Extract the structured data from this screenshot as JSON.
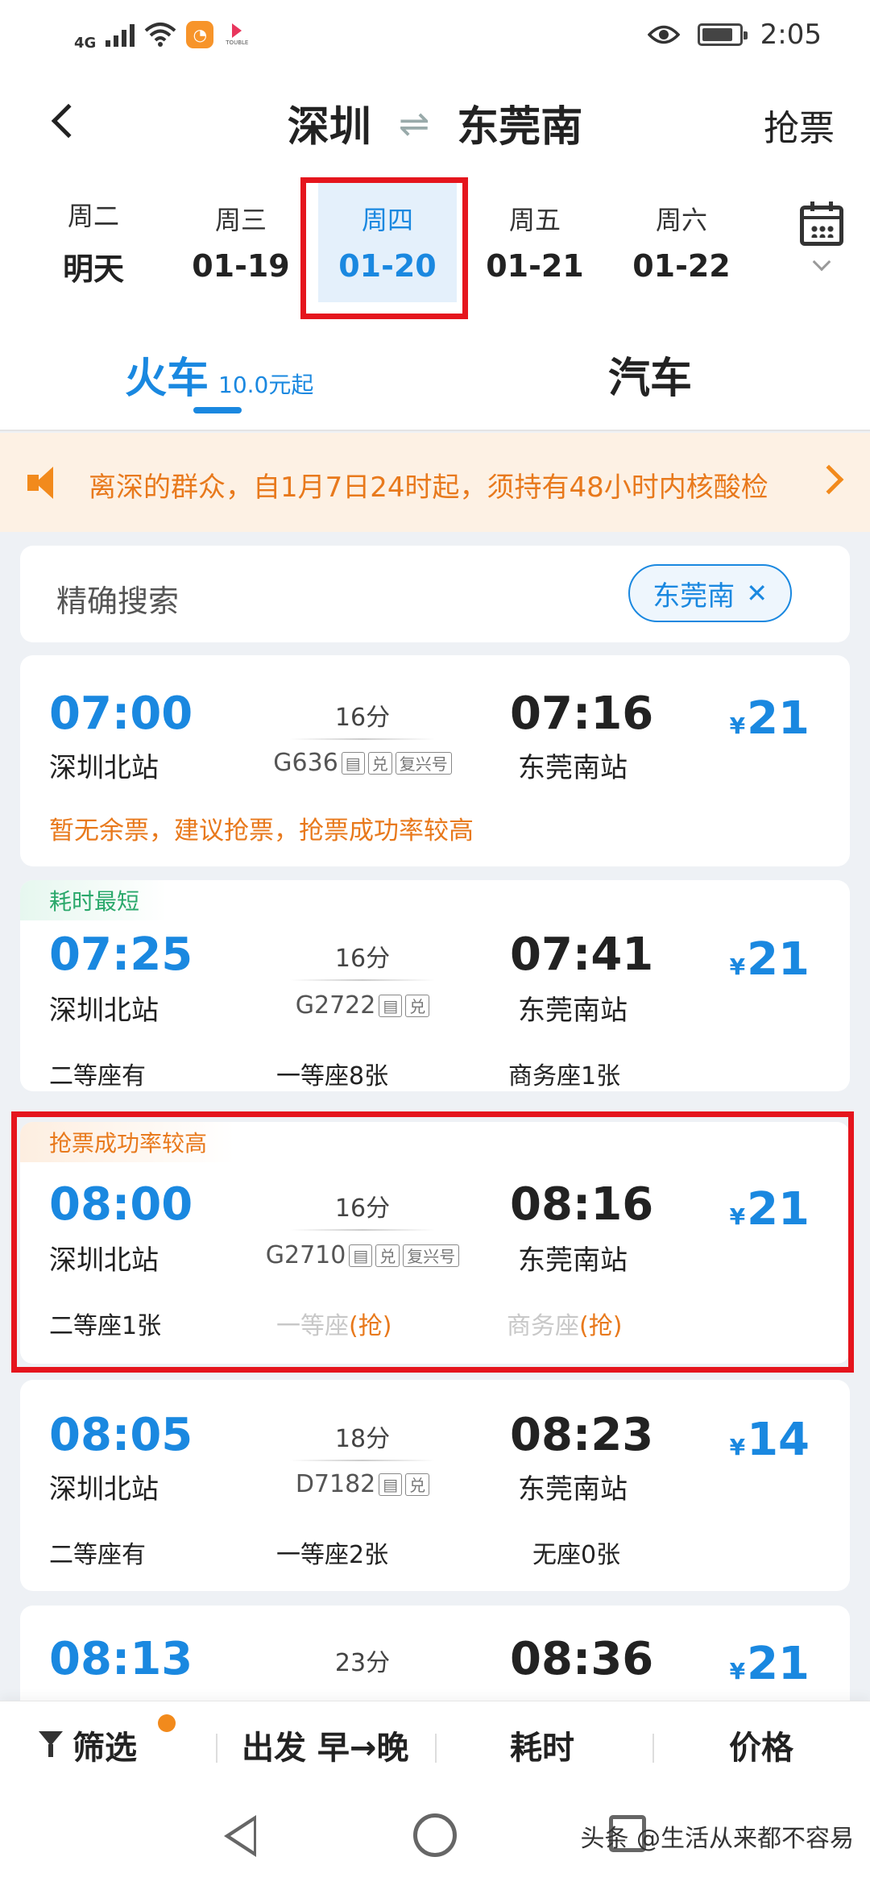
{
  "status_bar": {
    "network_label": "4G",
    "time": "2:05",
    "battery_percent": 85,
    "icons": [
      "signal-icon",
      "wifi-icon",
      "app-notification-icon",
      "video-app-icon",
      "eye-care-icon",
      "battery-icon"
    ]
  },
  "header": {
    "from": "深圳",
    "swap_symbol": "⇌",
    "to": "东莞南",
    "grab_ticket_label": "抢票"
  },
  "dates": [
    {
      "weekday": "周二",
      "date": "明天"
    },
    {
      "weekday": "周三",
      "date": "01-19"
    },
    {
      "weekday": "周四",
      "date": "01-20",
      "selected": true
    },
    {
      "weekday": "周五",
      "date": "01-21"
    },
    {
      "weekday": "周六",
      "date": "01-22"
    }
  ],
  "mode_tabs": {
    "train_label": "火车",
    "train_price_hint": "10.0元起",
    "bus_label": "汽车",
    "active": "train"
  },
  "notice": {
    "text": "离深的群众，自1月7日24时起，须持有48小时内核酸检"
  },
  "search": {
    "label": "精确搜索",
    "chip_label": "东莞南",
    "chip_close": "✕"
  },
  "trains": [
    {
      "tag": "",
      "dep_time": "07:00",
      "dep_station": "深圳北站",
      "duration": "16分",
      "train_no": "G636",
      "badges": [
        "身份",
        "兑",
        "复兴号"
      ],
      "arr_time": "07:16",
      "arr_station": "东莞南站",
      "currency": "¥",
      "price": "21",
      "warning": "暂无余票，建议抢票，抢票成功率较高"
    },
    {
      "tag": "耗时最短",
      "dep_time": "07:25",
      "dep_station": "深圳北站",
      "duration": "16分",
      "train_no": "G2722",
      "badges": [
        "身份",
        "兑"
      ],
      "arr_time": "07:41",
      "arr_station": "东莞南站",
      "currency": "¥",
      "price": "21",
      "seats": [
        "二等座有",
        "一等座8张",
        "商务座1张"
      ]
    },
    {
      "tag": "抢票成功率较高",
      "dep_time": "08:00",
      "dep_station": "深圳北站",
      "duration": "16分",
      "train_no": "G2710",
      "badges": [
        "身份",
        "兑",
        "复兴号"
      ],
      "arr_time": "08:16",
      "arr_station": "东莞南站",
      "currency": "¥",
      "price": "21",
      "seat1": "二等座1张",
      "seat2_name": "一等座",
      "seat2_action": "(抢)",
      "seat3_name": "商务座",
      "seat3_action": "(抢)"
    },
    {
      "tag": "",
      "dep_time": "08:05",
      "dep_station": "深圳北站",
      "duration": "18分",
      "train_no": "D7182",
      "badges": [
        "身份",
        "兑"
      ],
      "arr_time": "08:23",
      "arr_station": "东莞南站",
      "currency": "¥",
      "price": "14",
      "seats": [
        "二等座有",
        "一等座2张",
        "无座0张"
      ]
    },
    {
      "tag": "",
      "dep_time": "08:13",
      "duration": "23分",
      "arr_time": "08:36",
      "currency": "¥",
      "price": "21"
    }
  ],
  "sort_bar": {
    "filter_label": "筛选",
    "departure_label": "出发 早→晚",
    "duration_label": "耗时",
    "price_label": "价格"
  },
  "watermark": "头条 @生活从来都不容易",
  "colors": {
    "accent_blue": "#1a88e0",
    "warning_orange": "#e8791c",
    "highlight_red": "#e5151d",
    "tag_green": "#2aa86b"
  }
}
